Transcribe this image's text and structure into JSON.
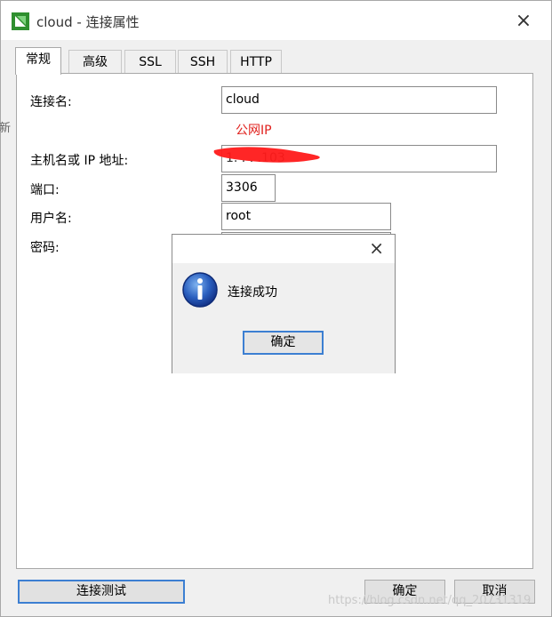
{
  "window": {
    "title": "cloud - 连接属性",
    "edge_text": "新"
  },
  "tabs": [
    {
      "label": "常规",
      "active": true
    },
    {
      "label": "高级",
      "active": false
    },
    {
      "label": "SSL",
      "active": false
    },
    {
      "label": "SSH",
      "active": false
    },
    {
      "label": "HTTP",
      "active": false
    }
  ],
  "form": {
    "connection_name_label": "连接名:",
    "connection_name_value": "cloud",
    "public_ip_note": "公网IP",
    "host_label": "主机名或 IP 地址:",
    "host_value": "1.     .     .     .103",
    "port_label": "端口:",
    "port_value": "3306",
    "username_label": "用户名:",
    "username_value": "root",
    "password_label": "密码:"
  },
  "dialog": {
    "message": "连接成功",
    "ok_label": "确定",
    "icon": "info-icon"
  },
  "footer": {
    "test_label": "连接测试",
    "ok_label": "确定",
    "cancel_label": "取消"
  },
  "watermark": "https://blog.csdn.net/qq_20731319",
  "colors": {
    "accent": "#3c7fd2",
    "note_red": "#e0201c",
    "redaction": "#ff1a1a",
    "app_icon_green": "#2f8f2f"
  }
}
